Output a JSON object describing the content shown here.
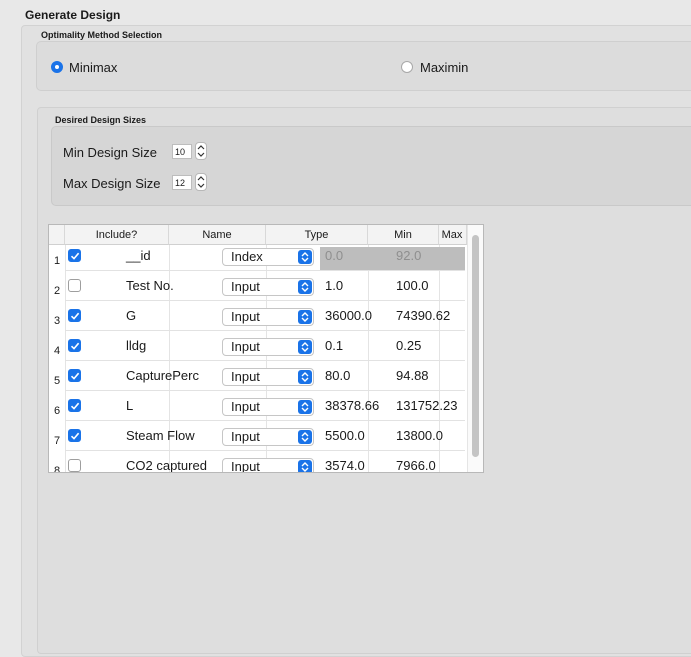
{
  "panel": {
    "title": "Generate Design"
  },
  "optimality": {
    "title": "Optimality Method Selection",
    "options": [
      {
        "label": "Minimax",
        "selected": true
      },
      {
        "label": "Maximin",
        "selected": false
      }
    ]
  },
  "sizes": {
    "title": "Desired Design Sizes",
    "min_label": "Min Design Size",
    "min_value": "10",
    "max_label": "Max Design Size",
    "max_value": "12"
  },
  "table": {
    "headers": [
      "Include?",
      "Name",
      "Type",
      "Min",
      "Max"
    ],
    "rows": [
      {
        "num": "1",
        "include": true,
        "name": "__id",
        "type": "Index",
        "min": "0.0",
        "max": "92.0",
        "disabled": true
      },
      {
        "num": "2",
        "include": false,
        "name": "Test No.",
        "type": "Input",
        "min": "1.0",
        "max": "100.0"
      },
      {
        "num": "3",
        "include": true,
        "name": "G",
        "type": "Input",
        "min": "36000.0",
        "max": "74390.62"
      },
      {
        "num": "4",
        "include": true,
        "name": "lldg",
        "type": "Input",
        "min": "0.1",
        "max": "0.25"
      },
      {
        "num": "5",
        "include": true,
        "name": "CapturePerc",
        "type": "Input",
        "min": "80.0",
        "max": "94.88"
      },
      {
        "num": "6",
        "include": true,
        "name": "L",
        "type": "Input",
        "min": "38378.66",
        "max": "131752.23"
      },
      {
        "num": "7",
        "include": true,
        "name": "Steam Flow",
        "type": "Input",
        "min": "5500.0",
        "max": "13800.0"
      },
      {
        "num": "8",
        "include": false,
        "name": "CO2 captured",
        "type": "Input",
        "min": "3574.0",
        "max": "7966.0"
      }
    ]
  },
  "colors": {
    "accent": "#1a73e8"
  }
}
